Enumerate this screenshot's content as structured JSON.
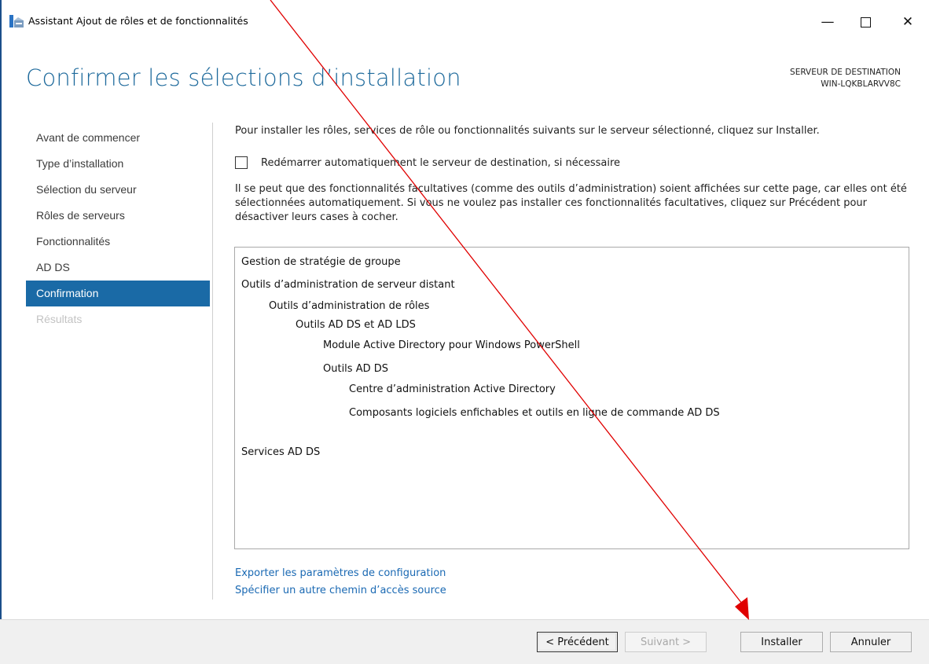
{
  "window": {
    "title": "Assistant Ajout de rôles et de fonctionnalités",
    "minimize": "—",
    "close": "✕"
  },
  "header": {
    "title": "Confirmer les sélections d’installation",
    "dest_label": "SERVEUR DE DESTINATION",
    "dest_server": "WIN-LQKBLARVV8C"
  },
  "nav": {
    "items": [
      {
        "label": "Avant de commencer"
      },
      {
        "label": "Type d’installation"
      },
      {
        "label": "Sélection du serveur"
      },
      {
        "label": "Rôles de serveurs"
      },
      {
        "label": "Fonctionnalités"
      },
      {
        "label": "AD DS"
      },
      {
        "label": "Confirmation"
      },
      {
        "label": "Résultats"
      }
    ]
  },
  "content": {
    "intro": "Pour installer les rôles, services de rôle ou fonctionnalités suivants sur le serveur sélectionné, cliquez sur Installer.",
    "restart_checkbox_label": "Redémarrer automatiquement le serveur de destination, si nécessaire",
    "restart_checked": false,
    "notice": "Il se peut que des fonctionnalités facultatives (comme des outils d’administration) soient affichées sur cette page, car elles ont été sélectionnées automatiquement. Si vous ne voulez pas installer ces fonctionnalités facultatives, cliquez sur Précédent pour désactiver leurs cases à cocher.",
    "tree": [
      {
        "label": "Gestion de stratégie de groupe"
      },
      {
        "label": "Outils d’administration de serveur distant"
      },
      {
        "label": "Outils d’administration de rôles"
      },
      {
        "label": "Outils AD DS et AD LDS"
      },
      {
        "label": "Module Active Directory pour Windows PowerShell"
      },
      {
        "label": "Outils AD DS"
      },
      {
        "label": "Centre d’administration Active Directory"
      },
      {
        "label": "Composants logiciels enfichables et outils en ligne de commande AD DS"
      },
      {
        "label": "Services AD DS"
      }
    ],
    "links": {
      "export": "Exporter les paramètres de configuration",
      "source_path": "Spécifier un autre chemin d’accès source"
    }
  },
  "footer": {
    "prev": "< Précédent",
    "next": "Suivant >",
    "install": "Installer",
    "cancel": "Annuler"
  },
  "colors": {
    "title_blue": "#1e6a9c",
    "nav_active_bg": "#1a6aa6",
    "link_blue": "#1a69b3",
    "annotation_red": "#e00000"
  }
}
